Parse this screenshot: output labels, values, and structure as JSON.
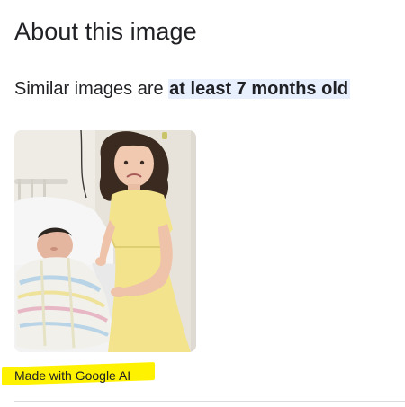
{
  "panel": {
    "title": "About this image",
    "summary_prefix": "Similar images are ",
    "summary_highlight": "at least 7 months old",
    "ai_label": "Made with Google AI",
    "highlight_color": "#fff200",
    "summary_highlight_bg": "#e8f0fe"
  }
}
